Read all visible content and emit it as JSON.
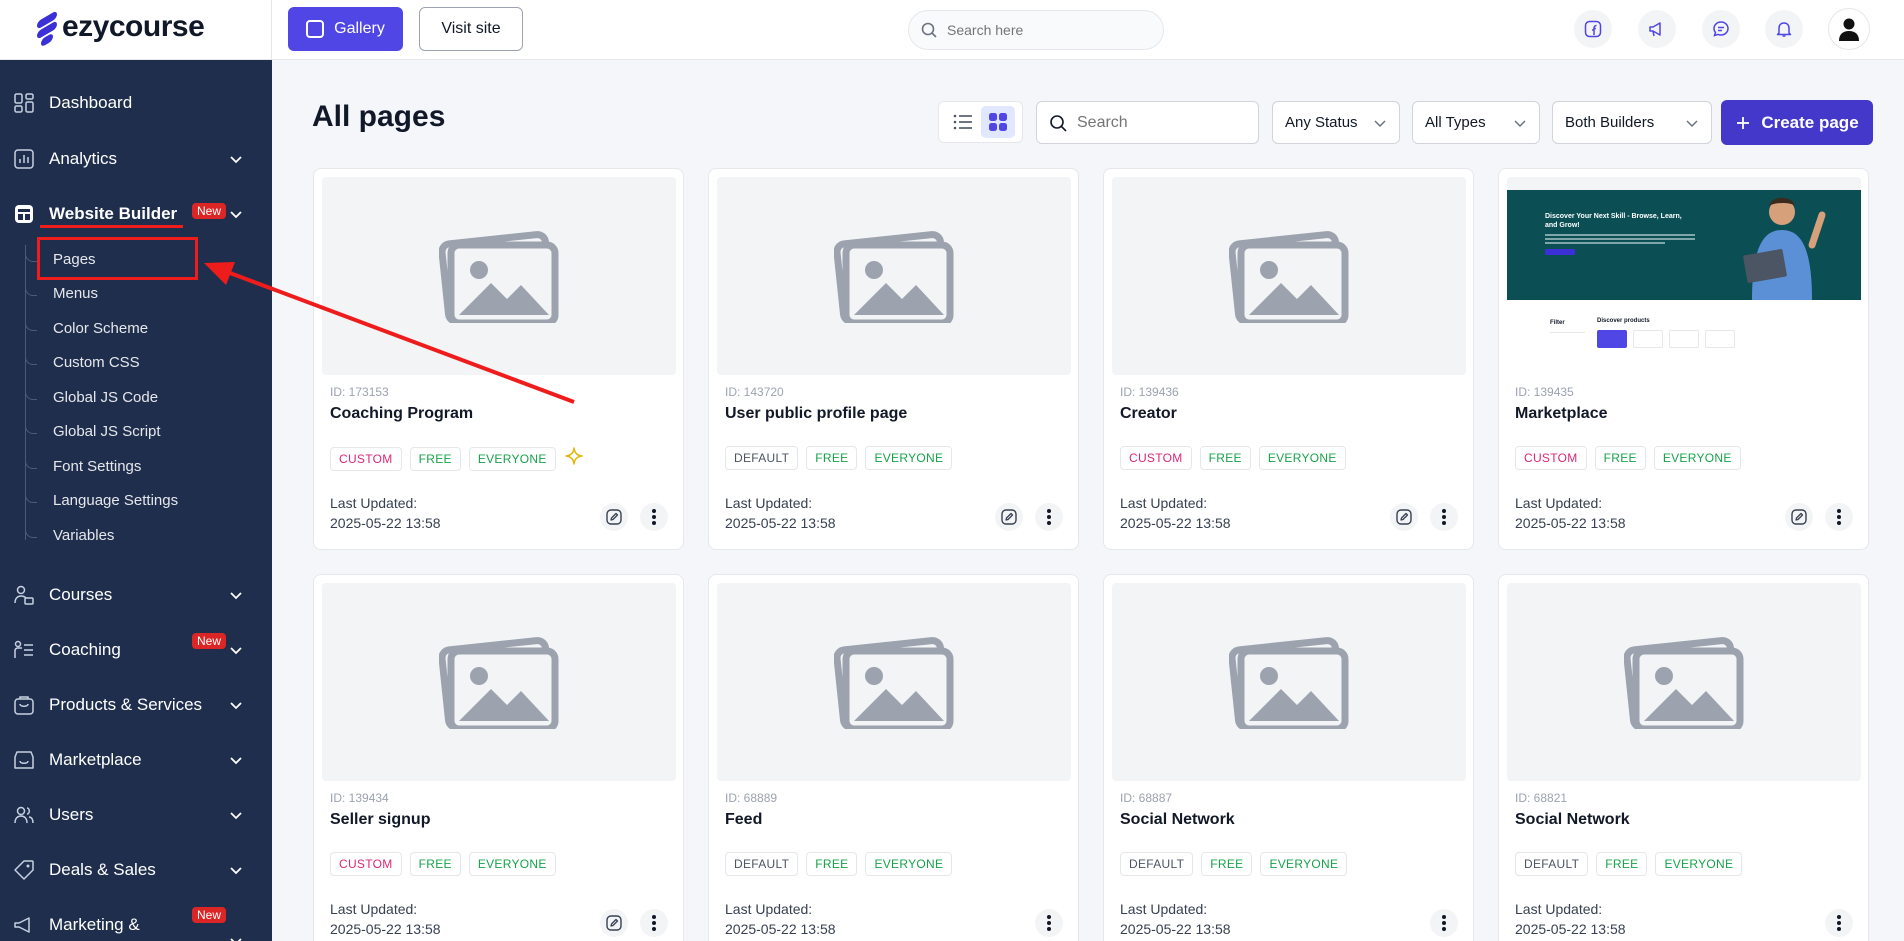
{
  "brand": {
    "name": "ezycourse"
  },
  "topbar": {
    "gallery_label": "Gallery",
    "visit_label": "Visit site",
    "search_placeholder": "Search here"
  },
  "sidebar": {
    "items": [
      {
        "label": "Dashboard",
        "icon": "dashboard-icon"
      },
      {
        "label": "Analytics",
        "icon": "analytics-icon"
      },
      {
        "label": "Website Builder",
        "icon": "website-builder-icon",
        "badge": "New"
      },
      {
        "label": "Courses",
        "icon": "courses-icon"
      },
      {
        "label": "Coaching",
        "icon": "coaching-icon",
        "badge": "New"
      },
      {
        "label": "Products & Services",
        "icon": "products-icon"
      },
      {
        "label": "Marketplace",
        "icon": "marketplace-icon"
      },
      {
        "label": "Users",
        "icon": "users-icon"
      },
      {
        "label": "Deals & Sales",
        "icon": "deals-icon"
      },
      {
        "label": "Marketing &",
        "icon": "marketing-icon",
        "badge": "New"
      }
    ],
    "subitems": [
      "Pages",
      "Menus",
      "Color Scheme",
      "Custom CSS",
      "Global JS Code",
      "Global JS Script",
      "Font Settings",
      "Language Settings",
      "Variables"
    ]
  },
  "main": {
    "title": "All pages",
    "search_placeholder": "Search",
    "filters": [
      "Any Status",
      "All Types",
      "Both Builders"
    ],
    "create_label": "Create page"
  },
  "labels": {
    "last_updated": "Last Updated:"
  },
  "hero": {
    "title": "Discover Your Next Skill - Browse, Learn, and Grow!",
    "filter": "Filter",
    "products": "Discover products"
  },
  "cards": [
    {
      "id": "ID: 173153",
      "name": "Coaching Program",
      "tags": [
        "CUSTOM",
        "FREE",
        "EVERYONE"
      ],
      "date": "2025-05-22 13:58"
    },
    {
      "id": "ID: 143720",
      "name": "User public profile page",
      "tags": [
        "DEFAULT",
        "FREE",
        "EVERYONE"
      ],
      "date": "2025-05-22 13:58"
    },
    {
      "id": "ID: 139436",
      "name": "Creator",
      "tags": [
        "CUSTOM",
        "FREE",
        "EVERYONE"
      ],
      "date": "2025-05-22 13:58"
    },
    {
      "id": "ID: 139435",
      "name": "Marketplace",
      "tags": [
        "CUSTOM",
        "FREE",
        "EVERYONE"
      ],
      "date": "2025-05-22 13:58"
    },
    {
      "id": "ID: 139434",
      "name": "Seller signup",
      "tags": [
        "CUSTOM",
        "FREE",
        "EVERYONE"
      ],
      "date": "2025-05-22 13:58"
    },
    {
      "id": "ID: 68889",
      "name": "Feed",
      "tags": [
        "DEFAULT",
        "FREE",
        "EVERYONE"
      ],
      "date": "2025-05-22 13:58"
    },
    {
      "id": "ID: 68887",
      "name": "Social Network",
      "tags": [
        "DEFAULT",
        "FREE",
        "EVERYONE"
      ],
      "date": "2025-05-22 13:58"
    },
    {
      "id": "ID: 68821",
      "name": "Social Network",
      "tags": [
        "DEFAULT",
        "FREE",
        "EVERYONE"
      ],
      "date": "2025-05-22 13:58"
    }
  ],
  "colors": {
    "sidebar": "#1f2e4d",
    "accent": "#4f46e5",
    "annotation": "#ef1c1c"
  }
}
